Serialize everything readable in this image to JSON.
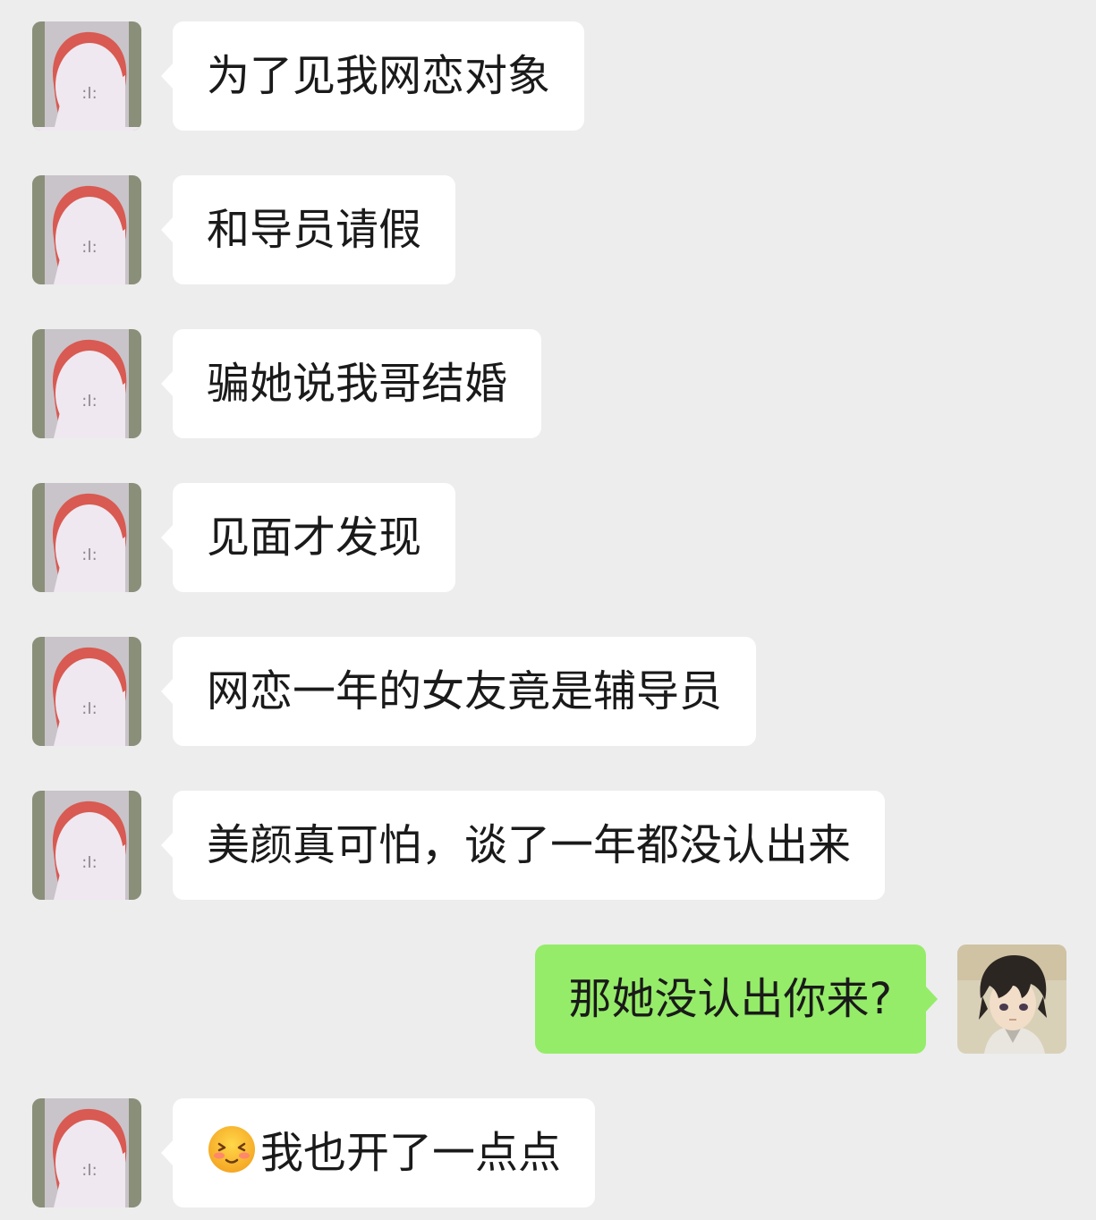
{
  "chat": {
    "colors": {
      "background": "#ededed",
      "incoming_bubble": "#ffffff",
      "outgoing_bubble": "#95ec69"
    },
    "messages": [
      {
        "side": "incoming",
        "avatar": "red-hood-avatar",
        "text": "为了见我网恋对象"
      },
      {
        "side": "incoming",
        "avatar": "red-hood-avatar",
        "text": "和导员请假"
      },
      {
        "side": "incoming",
        "avatar": "red-hood-avatar",
        "text": "骗她说我哥结婚"
      },
      {
        "side": "incoming",
        "avatar": "red-hood-avatar",
        "text": "见面才发现"
      },
      {
        "side": "incoming",
        "avatar": "red-hood-avatar",
        "text": "网恋一年的女友竟是辅导员"
      },
      {
        "side": "incoming",
        "avatar": "red-hood-avatar",
        "text": "美颜真可怕，谈了一年都没认出来"
      },
      {
        "side": "outgoing",
        "avatar": "anime-boy-avatar",
        "text": "那她没认出你来?"
      },
      {
        "side": "incoming",
        "avatar": "red-hood-avatar",
        "emoji": "shy-face-emoji",
        "text": "我也开了一点点"
      }
    ]
  }
}
